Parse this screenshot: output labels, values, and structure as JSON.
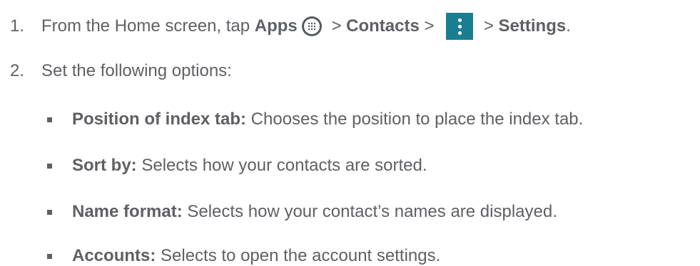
{
  "steps": [
    {
      "number": "1.",
      "parts": {
        "lead": "From the Home screen, tap ",
        "apps": "Apps",
        "sep1": " > ",
        "contacts": "Contacts",
        "sep2": " > ",
        "sep3": " > ",
        "settings": "Settings",
        "end": "."
      }
    },
    {
      "number": "2.",
      "text": "Set the following options:"
    }
  ],
  "options": [
    {
      "label": "Position of index tab:",
      "description": " Chooses the position to place the index tab."
    },
    {
      "label": "Sort by:",
      "description": " Selects how your contacts are sorted."
    },
    {
      "label": "Name format:",
      "description": " Selects how your contact’s names are displayed."
    },
    {
      "label": "Accounts:",
      "description": " Selects to open the account settings."
    }
  ],
  "icons": {
    "apps": "apps-grid-icon",
    "menu": "overflow-menu-icon"
  },
  "colors": {
    "text": "#5f6064",
    "menu_icon_bg": "#1a7e93",
    "apps_icon_bg": "#555a5f"
  }
}
